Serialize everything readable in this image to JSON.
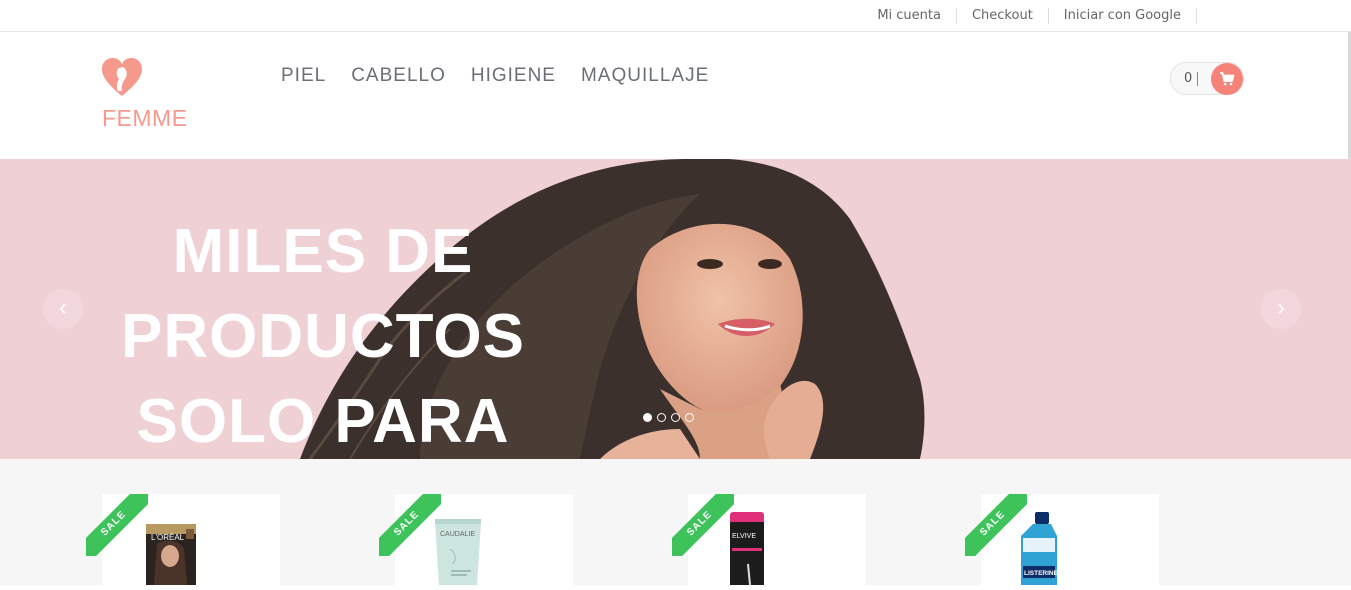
{
  "toplinks": [
    "Mi cuenta",
    "Checkout",
    "Iniciar con Google"
  ],
  "brand": {
    "name": "FEMME",
    "accent": "#f6998d"
  },
  "nav": [
    "PIEL",
    "CABELLO",
    "HIGIENE",
    "MAQUILLAJE"
  ],
  "cart": {
    "count": "0",
    "icon": "shopping-cart-icon",
    "color": "#f6837a"
  },
  "hero": {
    "line1": "MILES DE",
    "line2": "PRODUCTOS",
    "line3": "SOLO PARA TI",
    "prev_icon": "chevron-left-icon",
    "next_icon": "chevron-right-icon",
    "slides": 4,
    "active_slide": 1,
    "background": "#efd0d5"
  },
  "products": [
    {
      "badge": "SALE",
      "brand": "L'ORÉAL"
    },
    {
      "badge": "SALE",
      "brand": "CAUDALIE"
    },
    {
      "badge": "SALE",
      "brand": "ELVIVE"
    },
    {
      "badge": "SALE",
      "brand": "LISTERINE"
    }
  ],
  "badge_color": "#3ec35a"
}
